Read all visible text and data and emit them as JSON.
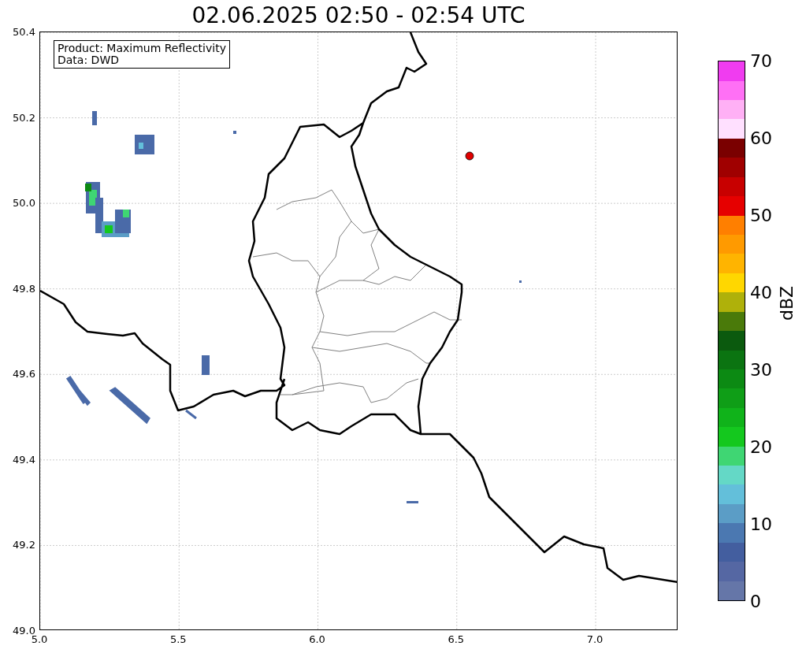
{
  "title": "02.06.2025 02:50 - 02:54 UTC",
  "info_box": [
    "Product: Maximum Reflectivity",
    "Data: DWD"
  ],
  "x_ticks": [
    "5.0",
    "5.5",
    "6.0",
    "6.5",
    "7.0"
  ],
  "y_ticks": [
    "50.4",
    "50.2",
    "50.0",
    "49.8",
    "49.6",
    "49.4",
    "49.2",
    "49.0"
  ],
  "colorbar": {
    "label": "dBZ",
    "ticks": [
      "70",
      "60",
      "50",
      "40",
      "30",
      "20",
      "10",
      "0"
    ],
    "bands": [
      {
        "color": "#6576a8"
      },
      {
        "color": "#5567a3"
      },
      {
        "color": "#435e9f"
      },
      {
        "color": "#4b78b1"
      },
      {
        "color": "#5b9dc6"
      },
      {
        "color": "#63bfda"
      },
      {
        "color": "#64d8c6"
      },
      {
        "color": "#3fd673"
      },
      {
        "color": "#14c81e"
      },
      {
        "color": "#10b31a"
      },
      {
        "color": "#0f9e17"
      },
      {
        "color": "#0c8a13"
      },
      {
        "color": "#0b7411"
      },
      {
        "color": "#0b5a0e"
      },
      {
        "color": "#4a7a0a"
      },
      {
        "color": "#afb10a"
      },
      {
        "color": "#ffd700"
      },
      {
        "color": "#ffb400"
      },
      {
        "color": "#ff9a00"
      },
      {
        "color": "#ff7f00"
      },
      {
        "color": "#e60000"
      },
      {
        "color": "#c80000"
      },
      {
        "color": "#a00000"
      },
      {
        "color": "#7a0000"
      },
      {
        "color": "#ffe0ff"
      },
      {
        "color": "#ffb0f5"
      },
      {
        "color": "#ff70f5"
      },
      {
        "color": "#f03cf0"
      }
    ]
  }
}
